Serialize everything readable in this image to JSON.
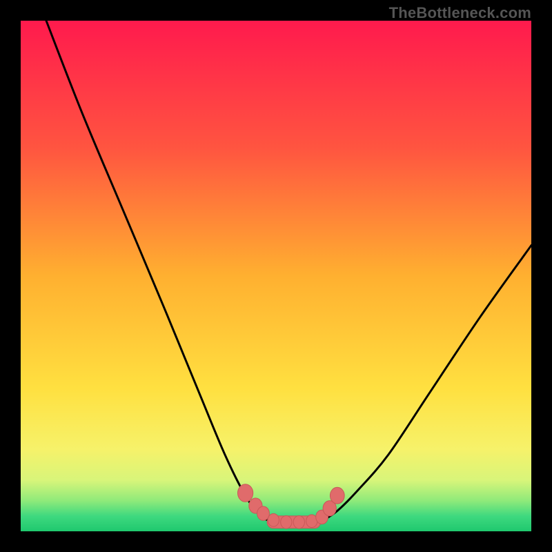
{
  "watermark": "TheBottleneck.com",
  "colors": {
    "frame": "#000000",
    "gradient_stops": [
      {
        "offset": 0.0,
        "color": "#ff1a4d"
      },
      {
        "offset": 0.25,
        "color": "#ff5540"
      },
      {
        "offset": 0.5,
        "color": "#ffb030"
      },
      {
        "offset": 0.72,
        "color": "#ffe040"
      },
      {
        "offset": 0.84,
        "color": "#f6f26a"
      },
      {
        "offset": 0.9,
        "color": "#d8f57a"
      },
      {
        "offset": 0.94,
        "color": "#8fea7a"
      },
      {
        "offset": 0.97,
        "color": "#3fd97f"
      },
      {
        "offset": 1.0,
        "color": "#1fc86e"
      }
    ],
    "curve_stroke": "#000000",
    "marker_fill": "#e06b6b",
    "marker_stroke": "#c85858"
  },
  "chart_data": {
    "type": "line",
    "title": "",
    "xlabel": "",
    "ylabel": "",
    "xlim": [
      0,
      1
    ],
    "ylim": [
      0,
      1
    ],
    "series": [
      {
        "name": "left-curve",
        "x": [
          0.05,
          0.12,
          0.2,
          0.28,
          0.35,
          0.4,
          0.44,
          0.47,
          0.49
        ],
        "y": [
          1.0,
          0.82,
          0.63,
          0.44,
          0.27,
          0.15,
          0.07,
          0.03,
          0.02
        ]
      },
      {
        "name": "right-curve",
        "x": [
          0.59,
          0.62,
          0.66,
          0.72,
          0.8,
          0.9,
          1.0
        ],
        "y": [
          0.02,
          0.04,
          0.08,
          0.15,
          0.27,
          0.42,
          0.56
        ]
      },
      {
        "name": "flat-bottom",
        "x": [
          0.49,
          0.52,
          0.55,
          0.58,
          0.59
        ],
        "y": [
          0.02,
          0.018,
          0.018,
          0.018,
          0.02
        ]
      }
    ],
    "markers": {
      "name": "bottom-markers",
      "points": [
        {
          "x": 0.44,
          "y": 0.075,
          "r": 0.015
        },
        {
          "x": 0.46,
          "y": 0.05,
          "r": 0.013
        },
        {
          "x": 0.475,
          "y": 0.035,
          "r": 0.012
        },
        {
          "x": 0.495,
          "y": 0.022,
          "r": 0.011
        },
        {
          "x": 0.52,
          "y": 0.018,
          "r": 0.011
        },
        {
          "x": 0.545,
          "y": 0.018,
          "r": 0.011
        },
        {
          "x": 0.57,
          "y": 0.02,
          "r": 0.011
        },
        {
          "x": 0.59,
          "y": 0.028,
          "r": 0.012
        },
        {
          "x": 0.605,
          "y": 0.045,
          "r": 0.013
        },
        {
          "x": 0.62,
          "y": 0.07,
          "r": 0.014
        }
      ],
      "bar": {
        "x0": 0.485,
        "x1": 0.585,
        "y": 0.018,
        "r": 0.012
      }
    }
  }
}
